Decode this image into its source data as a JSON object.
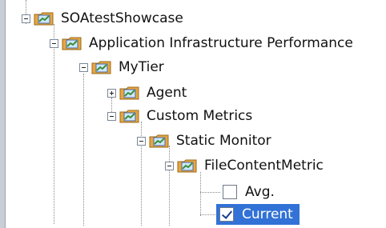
{
  "tree": {
    "nodes": [
      {
        "label": "SOAtestShowcase",
        "expanded": true
      },
      {
        "label": "Application Infrastructure Performance",
        "expanded": true
      },
      {
        "label": "MyTier",
        "expanded": true
      },
      {
        "label": "Agent",
        "expanded": false
      },
      {
        "label": "Custom Metrics",
        "expanded": true
      },
      {
        "label": "Static Monitor",
        "expanded": true
      },
      {
        "label": "FileContentMetric",
        "expanded": true
      }
    ],
    "leaves": [
      {
        "label": "Avg.",
        "checked": false,
        "selected": false
      },
      {
        "label": "Current",
        "checked": true,
        "selected": true
      }
    ]
  },
  "colors": {
    "selection": "#3272d6",
    "folder": "#e8a640",
    "chart_icon": "#3a8f3a"
  },
  "icons": {
    "folder": "folder-chart-icon",
    "expanded": "minus-toggle-icon",
    "collapsed": "plus-toggle-icon"
  }
}
